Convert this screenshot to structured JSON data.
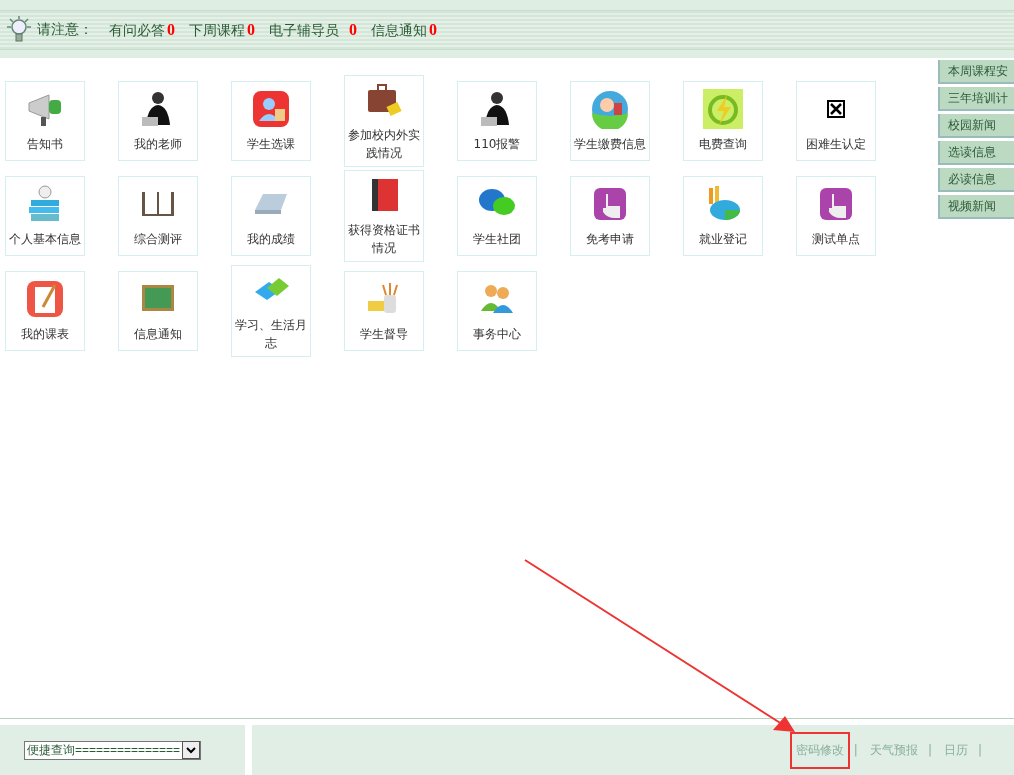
{
  "notice": {
    "label": "请注意：",
    "items": [
      {
        "label": "有问必答",
        "count": "0"
      },
      {
        "label": "下周课程",
        "count": "0"
      },
      {
        "label": "电子辅导员",
        "count": "0"
      },
      {
        "label": "信息通知",
        "count": "0"
      }
    ]
  },
  "tiles": [
    {
      "label": "告知书"
    },
    {
      "label": "我的老师"
    },
    {
      "label": "学生选课"
    },
    {
      "label": "参加校内外实践情况"
    },
    {
      "label": "110报警"
    },
    {
      "label": "学生缴费信息"
    },
    {
      "label": "电费查询"
    },
    {
      "label": "困难生认定"
    },
    {
      "label": "个人基本信息"
    },
    {
      "label": "综合测评"
    },
    {
      "label": "我的成绩"
    },
    {
      "label": "获得资格证书情况"
    },
    {
      "label": "学生社团"
    },
    {
      "label": "免考申请"
    },
    {
      "label": "就业登记"
    },
    {
      "label": "测试单点"
    },
    {
      "label": "我的课表"
    },
    {
      "label": "信息通知"
    },
    {
      "label": "学习、生活月志"
    },
    {
      "label": "学生督导"
    },
    {
      "label": "事务中心"
    }
  ],
  "side_links": [
    {
      "label": "本周课程安"
    },
    {
      "label": "三年培训计"
    },
    {
      "label": "校园新闻"
    },
    {
      "label": "选读信息"
    },
    {
      "label": "必读信息"
    },
    {
      "label": "视频新闻"
    }
  ],
  "quick_select": {
    "value": "便捷查询==============="
  },
  "footer_links": [
    {
      "label": "密码修改",
      "separator": "|",
      "highlighted": true
    },
    {
      "label": "天气预报",
      "separator": "|",
      "highlighted": false
    },
    {
      "label": "日历",
      "separator": "|",
      "highlighted": false
    }
  ]
}
